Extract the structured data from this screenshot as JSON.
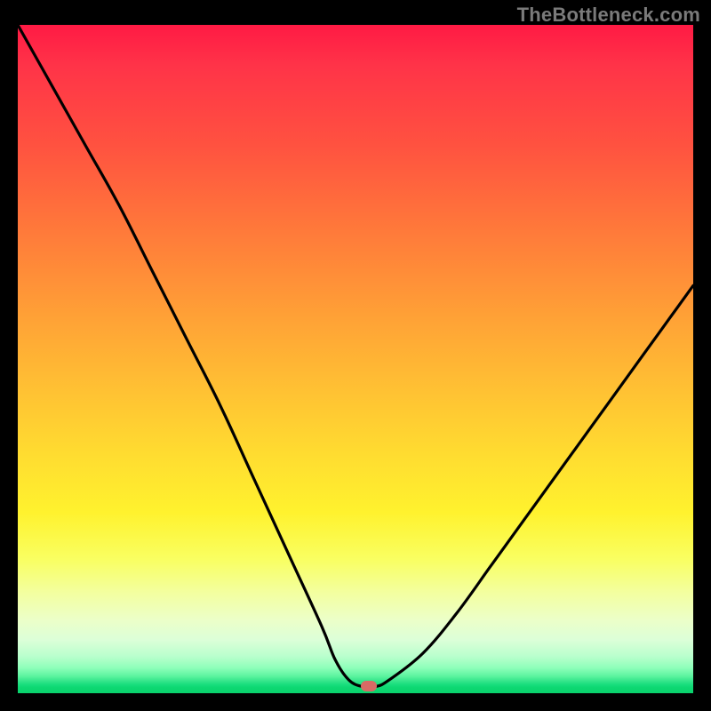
{
  "watermark": "TheBottleneck.com",
  "chart_data": {
    "type": "line",
    "title": "",
    "xlabel": "",
    "ylabel": "",
    "xlim": [
      0,
      100
    ],
    "ylim": [
      0,
      100
    ],
    "grid": false,
    "background_gradient": {
      "stops": [
        {
          "pos": 0,
          "color": "#ff1a44"
        },
        {
          "pos": 50,
          "color": "#ffc233"
        },
        {
          "pos": 80,
          "color": "#f9ff62"
        },
        {
          "pos": 100,
          "color": "#0ad36d"
        }
      ]
    },
    "series": [
      {
        "name": "bottleneck-curve",
        "color": "#000000",
        "x": [
          0,
          5,
          10,
          15,
          20,
          25,
          30,
          35,
          40,
          45,
          47,
          49,
          51,
          53,
          55,
          60,
          65,
          70,
          75,
          80,
          85,
          90,
          95,
          100
        ],
        "y": [
          100,
          91,
          82,
          73,
          63,
          53,
          43,
          32,
          21,
          10,
          5,
          2,
          1,
          1,
          2,
          6,
          12,
          19,
          26,
          33,
          40,
          47,
          54,
          61
        ]
      }
    ],
    "marker": {
      "x": 52,
      "y": 1,
      "color": "#d86a65"
    }
  }
}
